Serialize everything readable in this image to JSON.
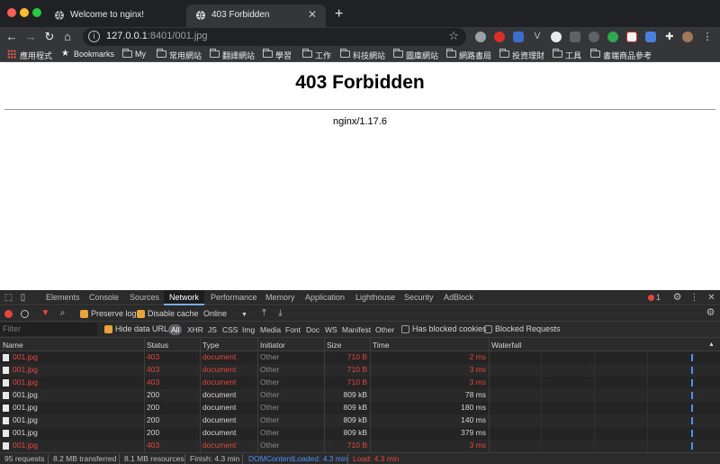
{
  "browser": {
    "tabs": [
      {
        "title": "Welcome to nginx!",
        "active": false
      },
      {
        "title": "403 Forbidden",
        "active": true
      }
    ],
    "url_host": "127.0.0.1",
    "url_rest": ":8401/001.jpg",
    "bookmarks": [
      "應用程式",
      "Bookmarks",
      "My",
      "常用網站",
      "翻譯網站",
      "學習",
      "工作",
      "科技網站",
      "圖庫網站",
      "網路書局",
      "投資理財",
      "工具",
      "書端商品參考"
    ]
  },
  "page": {
    "heading": "403 Forbidden",
    "server": "nginx/1.17.6"
  },
  "devtools": {
    "tabs": [
      "Elements",
      "Console",
      "Sources",
      "Network",
      "Performance",
      "Memory",
      "Application",
      "Lighthouse",
      "Security",
      "AdBlock"
    ],
    "active_tab": "Network",
    "error_count": "1",
    "preserve_log": "Preserve log",
    "disable_cache": "Disable cache",
    "throttle": "Online",
    "filter_placeholder": "Filter",
    "hide_data_urls": "Hide data URLs",
    "type_filters": [
      "All",
      "XHR",
      "JS",
      "CSS",
      "Img",
      "Media",
      "Font",
      "Doc",
      "WS",
      "Manifest",
      "Other"
    ],
    "has_blocked_cookies": "Has blocked cookies",
    "blocked_requests": "Blocked Requests",
    "columns": [
      "Name",
      "Status",
      "Type",
      "Initiator",
      "Size",
      "Time",
      "Waterfall"
    ],
    "requests": [
      {
        "name": "001.jpg",
        "status": "403",
        "type": "document",
        "initiator": "Other",
        "size": "710 B",
        "time": "2 ms",
        "error": true
      },
      {
        "name": "001.jpg",
        "status": "403",
        "type": "document",
        "initiator": "Other",
        "size": "710 B",
        "time": "3 ms",
        "error": true
      },
      {
        "name": "001.jpg",
        "status": "403",
        "type": "document",
        "initiator": "Other",
        "size": "710 B",
        "time": "3 ms",
        "error": true
      },
      {
        "name": "001.jpg",
        "status": "200",
        "type": "document",
        "initiator": "Other",
        "size": "809 kB",
        "time": "78 ms",
        "error": false
      },
      {
        "name": "001.jpg",
        "status": "200",
        "type": "document",
        "initiator": "Other",
        "size": "809 kB",
        "time": "180 ms",
        "error": false
      },
      {
        "name": "001.jpg",
        "status": "200",
        "type": "document",
        "initiator": "Other",
        "size": "809 kB",
        "time": "140 ms",
        "error": false
      },
      {
        "name": "001.jpg",
        "status": "200",
        "type": "document",
        "initiator": "Other",
        "size": "809 kB",
        "time": "379 ms",
        "error": false
      },
      {
        "name": "001.jpg",
        "status": "403",
        "type": "document",
        "initiator": "Other",
        "size": "710 B",
        "time": "3 ms",
        "error": true
      }
    ],
    "summary": {
      "requests": "95 requests",
      "transferred": "8.2 MB transferred",
      "resources": "8.1 MB resources",
      "finish": "Finish: 4.3 min",
      "dom_loaded": "DOMContentLoaded: 4.3 min",
      "load": "Load: 4.3 min"
    }
  },
  "colors": {
    "error_red": "#e0473d",
    "dom_blue": "#4e8ef7",
    "load_red": "#e0473d",
    "accent_orange": "#e8a33d"
  }
}
